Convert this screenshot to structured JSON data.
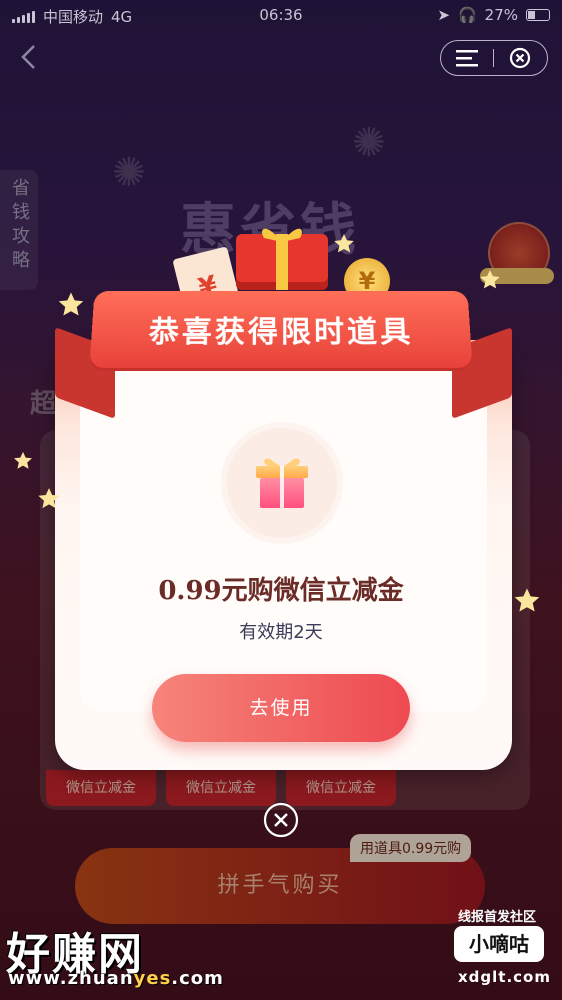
{
  "status_bar": {
    "carrier": "中国移动",
    "network": "4G",
    "time": "06:36",
    "battery": "27%"
  },
  "nav": {
    "back_icon": "chevron-left-icon",
    "menu_icon": "menu-icon",
    "close_icon": "close-circle-icon"
  },
  "background": {
    "side_tab": "省钱攻略",
    "banner_title": "惠省钱",
    "section_chip": "超",
    "cards": [
      "微信立减金",
      "微信立减金",
      "微信立减金"
    ],
    "big_button": "拼手气购买",
    "hint_bubble": "用道具0.99元购"
  },
  "modal": {
    "ribbon_title": "恭喜获得限时道具",
    "envelope_glyph": "¥",
    "coin_glyph": "¥",
    "coupon_title": "0.99元购微信立减金",
    "validity": "有效期2天",
    "use_button": "去使用"
  },
  "watermark": {
    "site_name": "好赚网",
    "site_url_prefix": "www.zhuan",
    "site_url_highlight": "yes",
    "site_url_suffix": ".com",
    "right_line1": "线报首发社区",
    "right_brand": "小嘀咕",
    "right_url": "xdglt.com"
  },
  "colors": {
    "ribbon": "#e8423a",
    "button_start": "#f6847a",
    "button_end": "#ee4a51",
    "title_text": "#6b2c28"
  }
}
